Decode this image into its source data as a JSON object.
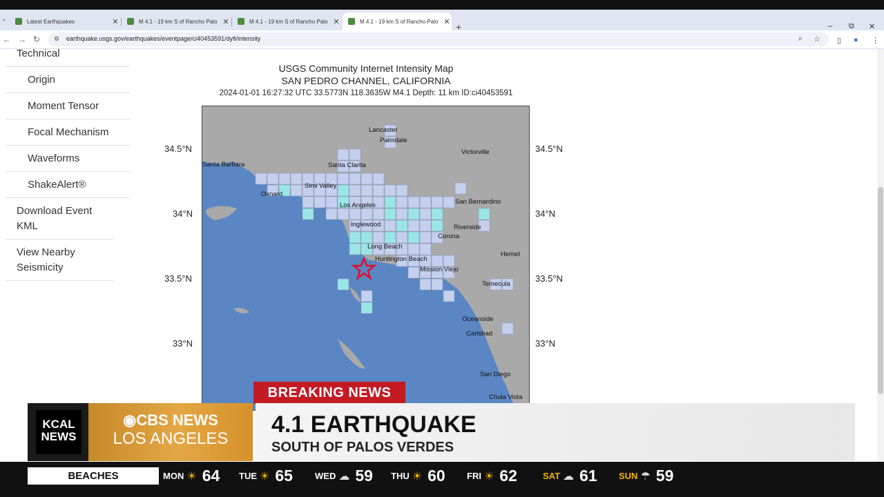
{
  "browser": {
    "tabs": [
      {
        "title": "Latest Earthquakes"
      },
      {
        "title": "M 4.1 - 19 km S of Rancho Palo"
      },
      {
        "title": "M 4.1 - 19 km S of Rancho Palo"
      },
      {
        "title": "M 4.1 - 19 km S of Rancho Palo"
      }
    ],
    "url": "earthquake.usgs.gov/earthquakes/eventpage/ci40453591/dyfi/intensity"
  },
  "sidebar": {
    "items": [
      {
        "label": "Technical"
      },
      {
        "label": "Origin"
      },
      {
        "label": "Moment Tensor"
      },
      {
        "label": "Focal Mechanism"
      },
      {
        "label": "Waveforms"
      },
      {
        "label": "ShakeAlert®"
      },
      {
        "label": "Download Event KML"
      },
      {
        "label": "View Nearby Seismicity"
      }
    ]
  },
  "map": {
    "title": "USGS Community Internet Intensity Map",
    "region": "SAN PEDRO CHANNEL, CALIFORNIA",
    "details": "2024-01-01 16:27:32 UTC 33.5773N 118.3635W M4.1 Depth: 11 km ID:ci40453591",
    "lat_labels": [
      "34.5°N",
      "34°N",
      "33.5°N",
      "33°N"
    ],
    "places": [
      "Lancaster",
      "Palmdale",
      "Victorville",
      "Santa Barbara",
      "Santa Clarita",
      "Simi Valley",
      "Oxnard",
      "Los Angeles",
      "San Bernardino",
      "Inglewood",
      "Riverside",
      "Corona",
      "Long Beach",
      "Hemet",
      "Huntington Beach",
      "Mission Viejo",
      "Temecula",
      "Oceanside",
      "Carlsbad",
      "San Diego",
      "Chula Vista"
    ],
    "colors": {
      "ocean": "#5b86c4",
      "land": "#a9a9a9",
      "cell_light": "#c5cfee",
      "cell_aqua": "#9ae6e6",
      "epicenter": "#e0102a"
    }
  },
  "broadcast": {
    "breaking": "BREAKING NEWS",
    "station_kcal": "KCAL NEWS",
    "network_top": "CBS NEWS",
    "network_bottom": "LOS ANGELES",
    "headline": "4.1 EARTHQUAKE",
    "subheadline": "SOUTH OF PALOS VERDES",
    "colors": {
      "breaking_red": "#c41a24",
      "cbs_gold": "#e3a744"
    }
  },
  "ticker": {
    "label": "BEACHES",
    "days": [
      {
        "day": "MON",
        "icon": "sun-icon",
        "temp": "64"
      },
      {
        "day": "TUE",
        "icon": "sun-icon",
        "temp": "65"
      },
      {
        "day": "WED",
        "icon": "cloud-drizzle-icon",
        "temp": "59"
      },
      {
        "day": "THU",
        "icon": "sun-icon",
        "temp": "60"
      },
      {
        "day": "FRI",
        "icon": "sun-icon",
        "temp": "62"
      },
      {
        "day": "SAT",
        "icon": "cloud-drizzle-icon",
        "temp": "61"
      },
      {
        "day": "SUN",
        "icon": "rain-icon",
        "temp": "59"
      }
    ]
  }
}
